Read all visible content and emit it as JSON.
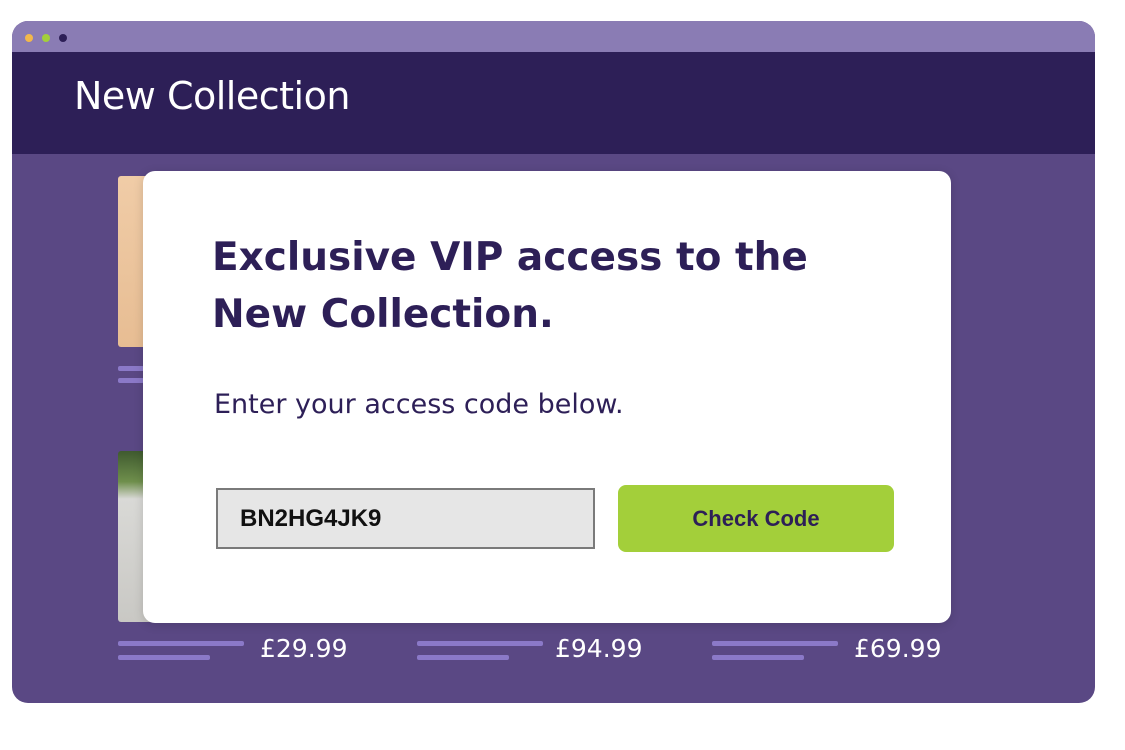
{
  "colors": {
    "titlebar": "#8a7cb4",
    "header": "#2d1f57",
    "page_background": "#5a4884",
    "accent_button": "#a3cf3a",
    "window_dots": [
      "#f2b84b",
      "#a3cf3a",
      "#2d1f57"
    ]
  },
  "header": {
    "title": "New Collection"
  },
  "modal": {
    "title": "Exclusive VIP access to the New Collection.",
    "instruction": "Enter your access code below.",
    "code_value": "BN2HG4JK9",
    "check_button_label": "Check Code"
  },
  "products": [
    {
      "price": "£29.99"
    },
    {
      "price": "£94.99"
    },
    {
      "price": "£69.99"
    }
  ]
}
